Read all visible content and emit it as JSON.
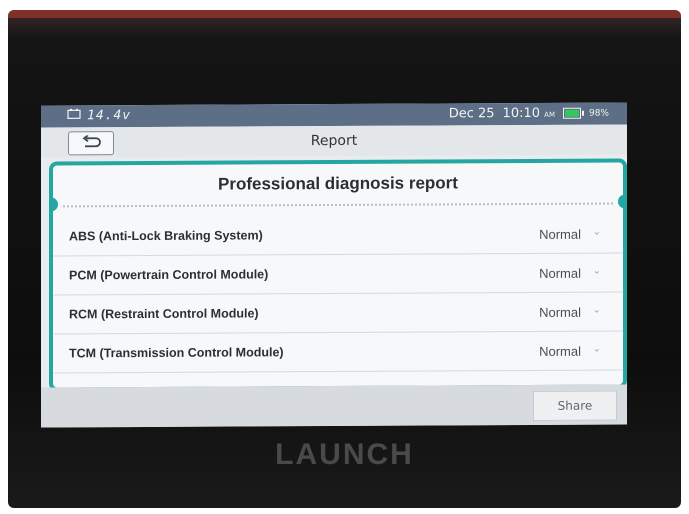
{
  "status_bar": {
    "voltage": "14.4v",
    "date": "Dec 25",
    "time": "10:10",
    "ampm": "AM",
    "battery_pct": "98%",
    "battery_level": 0.98,
    "battery_color": "#34c759"
  },
  "header": {
    "title": "Report",
    "back_icon": "back-arrow-icon"
  },
  "report": {
    "title": "Professional diagnosis report",
    "rows": [
      {
        "name": "ABS (Anti-Lock Braking System)",
        "status": "Normal"
      },
      {
        "name": "PCM (Powertrain Control Module)",
        "status": "Normal"
      },
      {
        "name": "RCM (Restraint Control Module)",
        "status": "Normal"
      },
      {
        "name": "TCM (Transmission Control Module)",
        "status": "Normal"
      }
    ]
  },
  "footer": {
    "share_label": "Share"
  },
  "device": {
    "brand": "LAUNCH"
  },
  "colors": {
    "accent": "#23a7a0",
    "status_bar": "#5d6f86"
  }
}
